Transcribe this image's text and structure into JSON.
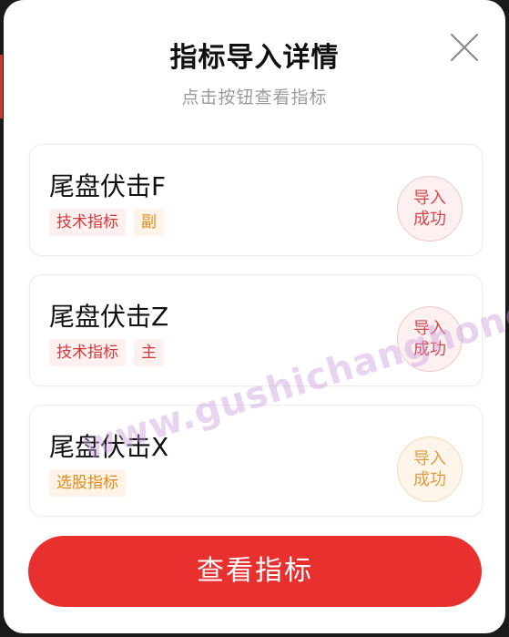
{
  "dialog": {
    "title": "指标导入详情",
    "subtitle": "点击按钮查看指标"
  },
  "cards": [
    {
      "name": "尾盘伏击F",
      "tags": [
        {
          "label": "技术指标",
          "color": "red"
        },
        {
          "label": "副",
          "color": "orange"
        }
      ],
      "status_line1": "导入",
      "status_line2": "成功",
      "status_color": "red"
    },
    {
      "name": "尾盘伏击Z",
      "tags": [
        {
          "label": "技术指标",
          "color": "red"
        },
        {
          "label": "主",
          "color": "red"
        }
      ],
      "status_line1": "导入",
      "status_line2": "成功",
      "status_color": "red"
    },
    {
      "name": "尾盘伏击X",
      "tags": [
        {
          "label": "选股指标",
          "color": "orange"
        }
      ],
      "status_line1": "导入",
      "status_line2": "成功",
      "status_color": "orange"
    }
  ],
  "primary_button": {
    "label": "查看指标"
  },
  "watermark": {
    "text": "www.gushichanghong.com"
  },
  "colors": {
    "accent": "#e8302f",
    "tag_red": "#d0393b",
    "tag_orange": "#e08a1e"
  }
}
